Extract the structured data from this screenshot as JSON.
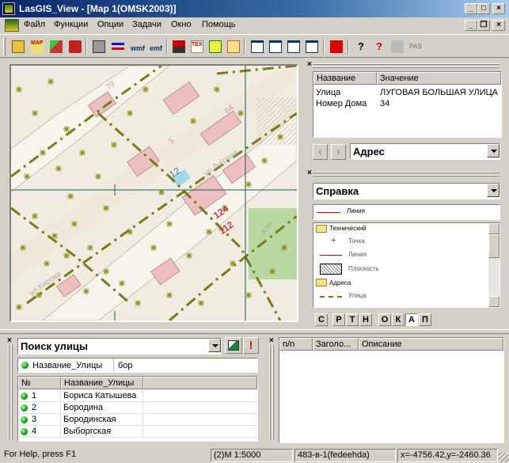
{
  "window": {
    "title": "LasGIS_View - [Map 1(OMSK2003)]",
    "caption_buttons": [
      "_",
      "□",
      "×"
    ],
    "doc_caption_buttons": [
      "_",
      "❐",
      "×"
    ]
  },
  "menu": [
    "Файл",
    "Функции",
    "Опции",
    "Задачи",
    "Окно",
    "Помощь"
  ],
  "toolbar": {
    "buttons": [
      {
        "icon": "open-folder-icon"
      },
      {
        "icon": "map-icon"
      },
      {
        "icon": "layers-icon"
      },
      {
        "icon": "book-icon"
      },
      {
        "icon": "print-icon"
      },
      {
        "icon": "exchange-icon"
      },
      {
        "icon": "wmf-export-icon"
      },
      {
        "icon": "emf-export-icon"
      },
      {
        "icon": "database-icon"
      },
      {
        "icon": "tex-icon"
      },
      {
        "icon": "dimension-icon"
      },
      {
        "icon": "grid-icon"
      },
      {
        "icon": "window-info-icon"
      },
      {
        "icon": "window-warning-icon"
      },
      {
        "icon": "window-list-icon"
      },
      {
        "icon": "window-save-icon"
      },
      {
        "icon": "red-p-icon"
      },
      {
        "icon": "help-icon"
      },
      {
        "icon": "context-help-icon"
      },
      {
        "icon": "tools-icon"
      },
      {
        "icon": "pas-icon"
      }
    ],
    "wmf_label": "wmf",
    "emf_label": "emf",
    "map_label": "MAP",
    "tex_label": "TEX",
    "pas_label": "PAS"
  },
  "map": {
    "labels": [
      "12",
      "124",
      "112",
      "64",
      "5",
      "79"
    ],
    "street_labels": [
      "ул.Луговая",
      "ул.Кирова",
      "Кон"
    ]
  },
  "attributes": {
    "columns": [
      "Название",
      "Значение"
    ],
    "rows": [
      {
        "name": "Улица",
        "value": "ЛУГОВАЯ БОЛЬШАЯ УЛИЦА"
      },
      {
        "name": "Номер Дома",
        "value": "34"
      }
    ],
    "nav_prev": "‹",
    "nav_next": "›",
    "combo_value": "Адрес"
  },
  "legend": {
    "combo_value": "Справка",
    "top_line_label": "Линия",
    "groups": [
      {
        "name": "Технический",
        "items": [
          {
            "symbol": "point",
            "label": "Точка"
          },
          {
            "symbol": "line",
            "label": "Линия"
          },
          {
            "symbol": "area",
            "label": "Плоскость"
          }
        ]
      },
      {
        "name": "Адреса",
        "items": [
          {
            "symbol": "dash",
            "label": "Улица"
          }
        ]
      }
    ],
    "abc_buttons": [
      "С",
      "Р",
      "Т",
      "Н",
      "О",
      "К",
      "А",
      "П"
    ]
  },
  "search": {
    "combo_value": "Поиск улицы",
    "filter_field": "Название_Улицы",
    "filter_value": "бор",
    "columns": [
      "№",
      "Название_Улицы"
    ],
    "rows": [
      {
        "n": "1",
        "name": "Бориса Катышева"
      },
      {
        "n": "2",
        "name": "Бородина"
      },
      {
        "n": "3",
        "name": "Бородинская"
      },
      {
        "n": "4",
        "name": "Выборгская"
      }
    ]
  },
  "messages": {
    "columns": [
      "n/n",
      "Заголо...",
      "Описание"
    ]
  },
  "statusbar": {
    "help": "For Help, press F1",
    "scale": "(2)M 1:5000",
    "object": "483-в-1(fedeehda)",
    "coords": "x=-4756.42,y=-2460.36"
  },
  "colors": {
    "title_start": "#0a246a",
    "title_end": "#a6caf0",
    "face": "#d4d0c8",
    "street_dash": "#7a7a1a",
    "tree": "#8a8a10",
    "building": "#e8b0b0",
    "crosshair": "#1a5a5a"
  }
}
